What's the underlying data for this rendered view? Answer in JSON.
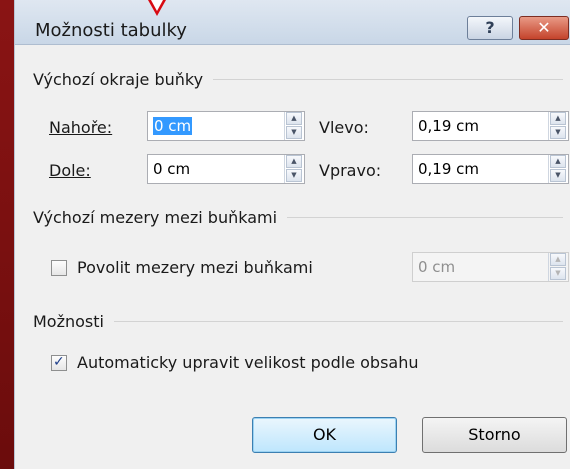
{
  "dialog": {
    "title": "Možnosti tabulky",
    "help_glyph": "?",
    "close_glyph": "✕"
  },
  "margins": {
    "heading": "Výchozí okraje buňky",
    "top_label": "Nahoře:",
    "top_value": "0 cm",
    "bottom_label": "Dole:",
    "bottom_value": "0 cm",
    "left_label": "Vlevo:",
    "left_value": "0,19 cm",
    "right_label": "Vpravo:",
    "right_value": "0,19 cm"
  },
  "spacing": {
    "heading": "Výchozí mezery mezi buňkami",
    "checkbox_label": "Povolit mezery mezi buňkami",
    "checked": false,
    "value": "0 cm"
  },
  "options": {
    "heading": "Možnosti",
    "autofit_label": "Automaticky upravit velikost podle obsahu",
    "autofit_checked": true
  },
  "buttons": {
    "ok": "OK",
    "cancel": "Storno"
  },
  "icons": {
    "check": "✓",
    "spin_up": "▲",
    "spin_down": "▼"
  }
}
